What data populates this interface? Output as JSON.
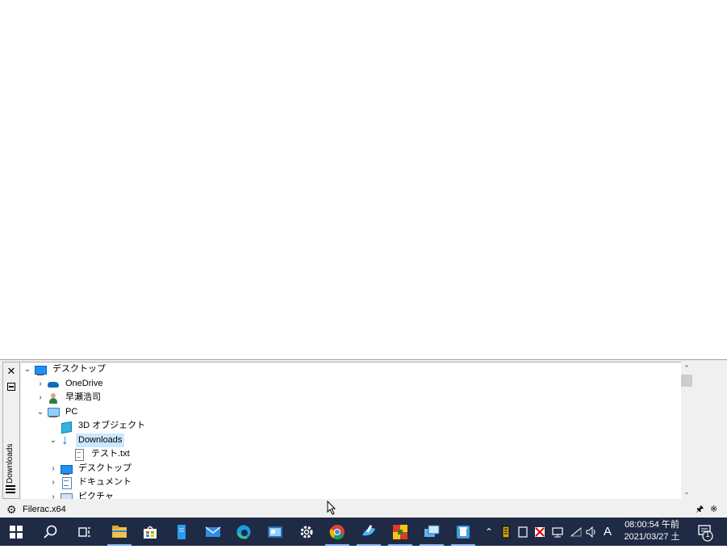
{
  "sidebar": {
    "close_glyph": "✕",
    "vertical_label": "Downloads"
  },
  "tree": {
    "items": [
      {
        "label": "デスクトップ",
        "icon": "desktop-icon",
        "expander": "expanded",
        "level": 0
      },
      {
        "label": "OneDrive",
        "icon": "onedrive-icon",
        "expander": "collapsed",
        "level": 1
      },
      {
        "label": "早瀬浩司",
        "icon": "user-icon",
        "expander": "collapsed",
        "level": 1
      },
      {
        "label": "PC",
        "icon": "pc-icon",
        "expander": "expanded",
        "level": 1
      },
      {
        "label": "3D オブジェクト",
        "icon": "3d-objects-icon",
        "expander": "none",
        "level": 2
      },
      {
        "label": "Downloads",
        "icon": "downloads-icon",
        "expander": "expanded",
        "level": 2,
        "selected": true
      },
      {
        "label": "テスト.txt",
        "icon": "text-file-icon",
        "expander": "none",
        "level": 3
      },
      {
        "label": "デスクトップ",
        "icon": "desktop-folder-icon",
        "expander": "collapsed",
        "level": 2
      },
      {
        "label": "ドキュメント",
        "icon": "documents-icon",
        "expander": "collapsed",
        "level": 2
      },
      {
        "label": "ピクチャ",
        "icon": "pictures-icon",
        "expander": "collapsed",
        "level": 2
      }
    ]
  },
  "statusbar": {
    "app_title": "Filerac.x64",
    "pin_glyph": "🖈",
    "close_glyph": "✕"
  },
  "taskbar": {
    "clock_time": "08:00:54 午前",
    "clock_date": "2021/03/27 土",
    "notification_count": "1",
    "ime_mode": "A",
    "accent": "#1f2a44",
    "apps": [
      "start-icon",
      "search-icon",
      "task-view-icon",
      "file-explorer-icon",
      "store-icon",
      "notepad-icon",
      "mail-icon",
      "edge-icon",
      "app-icon",
      "settings-icon",
      "chrome-icon",
      "paint-icon",
      "puzzle-app-icon",
      "remote-desktop-icon",
      "recycle-app-icon"
    ]
  }
}
